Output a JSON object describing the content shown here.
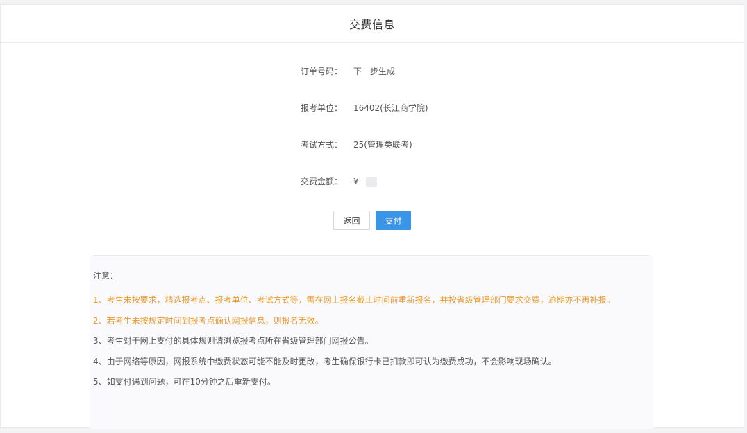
{
  "header": {
    "title": "交费信息"
  },
  "info": {
    "order_label": "订单号码：",
    "order_value": "下一步生成",
    "unit_label": "报考单位：",
    "unit_value": "16402(长江商学院)",
    "method_label": "考试方式：",
    "method_value": "25(管理类联考)",
    "amount_label": "交费金额：",
    "amount_value": "¥"
  },
  "buttons": {
    "back": "返回",
    "pay": "支付"
  },
  "notes": {
    "title": "注意：",
    "items": [
      "1、考生未按要求，精选报考点、报考单位、考试方式等，需在网上报名截止时间前重新报名，并按省级管理部门要求交费，逾期亦不再补报。",
      "2、若考生未按规定时间到报考点确认网报信息，则报名无效。",
      "3、考生对于网上支付的具体规则请浏览报考点所在省级管理部门网报公告。",
      "4、由于网络等原因，网报系统中缴费状态可能不能及时更改，考生确保银行卡已扣款即可认为缴费成功，不会影响现场确认。",
      "5、如支付遇到问题，可在10分钟之后重新支付。"
    ]
  },
  "colors": {
    "primary": "#3b95e6",
    "warning": "#e89a2c"
  }
}
